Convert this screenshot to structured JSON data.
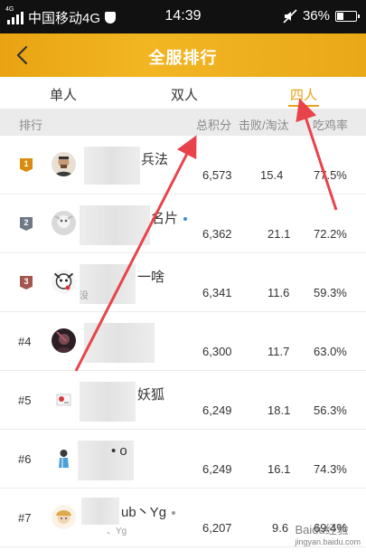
{
  "status_bar": {
    "network": "4G",
    "carrier": "中国移动4G",
    "time": "14:39",
    "battery": "36%",
    "battery_level": 0.36
  },
  "header": {
    "title": "全服排行",
    "back_icon": "chevron-left-icon"
  },
  "tabs": [
    {
      "label": "单人",
      "active": false
    },
    {
      "label": "双人",
      "active": false
    },
    {
      "label": "四人",
      "active": true
    }
  ],
  "columns": {
    "rank": "排行",
    "score": "总积分",
    "kd": "击败/淘汰",
    "win_rate": "吃鸡率"
  },
  "rows": [
    {
      "rank": "1",
      "name": "兵法",
      "sub": "",
      "score": "6,573",
      "kd": "15.4",
      "win_rate": "77.5%"
    },
    {
      "rank": "2",
      "name": "名片",
      "sub": "",
      "score": "6,362",
      "kd": "21.1",
      "win_rate": "72.2%"
    },
    {
      "rank": "3",
      "name": "一啥",
      "sub": "没",
      "score": "6,341",
      "kd": "11.6",
      "win_rate": "59.3%"
    },
    {
      "rank": "#4",
      "name": "",
      "sub": "",
      "score": "6,300",
      "kd": "11.7",
      "win_rate": "63.0%"
    },
    {
      "rank": "#5",
      "name": "妖狐",
      "sub": "",
      "score": "6,249",
      "kd": "18.1",
      "win_rate": "56.3%"
    },
    {
      "rank": "#6",
      "name": "•  o",
      "sub": "",
      "score": "6,249",
      "kd": "16.1",
      "win_rate": "74.3%"
    },
    {
      "rank": "#7",
      "name": "ub丶Yg",
      "sub": "、Yg",
      "score": "6,207",
      "kd": "9.6",
      "win_rate": "69.4%"
    }
  ],
  "watermark": {
    "text": "Baidu经验",
    "url": "jingyan.baidu.com"
  },
  "colors": {
    "accent": "#e8a31b",
    "gold": "#d98c10",
    "silver": "#6d7a85",
    "bronze": "#a2564d",
    "arrow": "#e8434a",
    "online_blue": "#3d8bd6",
    "online_gray": "#999999"
  }
}
